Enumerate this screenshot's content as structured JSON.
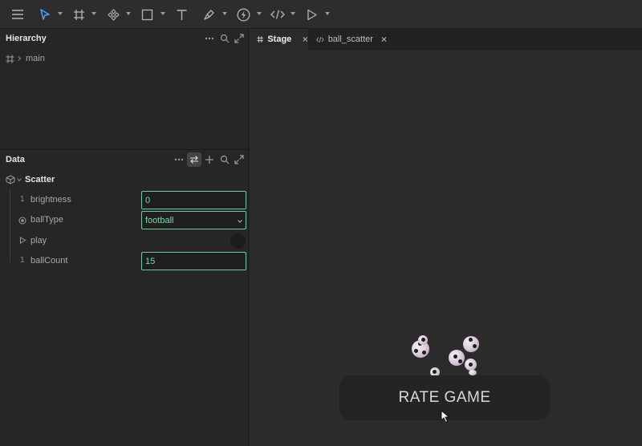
{
  "toolbar": {
    "icons": [
      "menu-icon",
      "select-arrow-icon",
      "frame-icon",
      "component-icon",
      "shape-icon",
      "text-icon",
      "pen-icon",
      "bolt-icon",
      "code-icon",
      "play-icon"
    ]
  },
  "hierarchy": {
    "title": "Hierarchy",
    "items": [
      {
        "label": "main"
      }
    ]
  },
  "data_panel": {
    "title": "Data",
    "object": "Scatter",
    "properties": [
      {
        "type": "1",
        "label": "brightness",
        "value": "0",
        "kind": "number"
      },
      {
        "type": "",
        "label": "ballType",
        "value": "football",
        "kind": "enum"
      },
      {
        "type": "",
        "label": "play",
        "value": "",
        "kind": "trigger"
      },
      {
        "type": "1",
        "label": "ballCount",
        "value": "15",
        "kind": "number"
      }
    ]
  },
  "tabs": [
    {
      "label": "Stage",
      "active": true
    },
    {
      "label": "ball_scatter",
      "active": false
    }
  ],
  "stage": {
    "button_label": "RATE GAME"
  },
  "colors": {
    "accent": "#6fc7a3",
    "toolbar_active": "#4aa3ff"
  }
}
